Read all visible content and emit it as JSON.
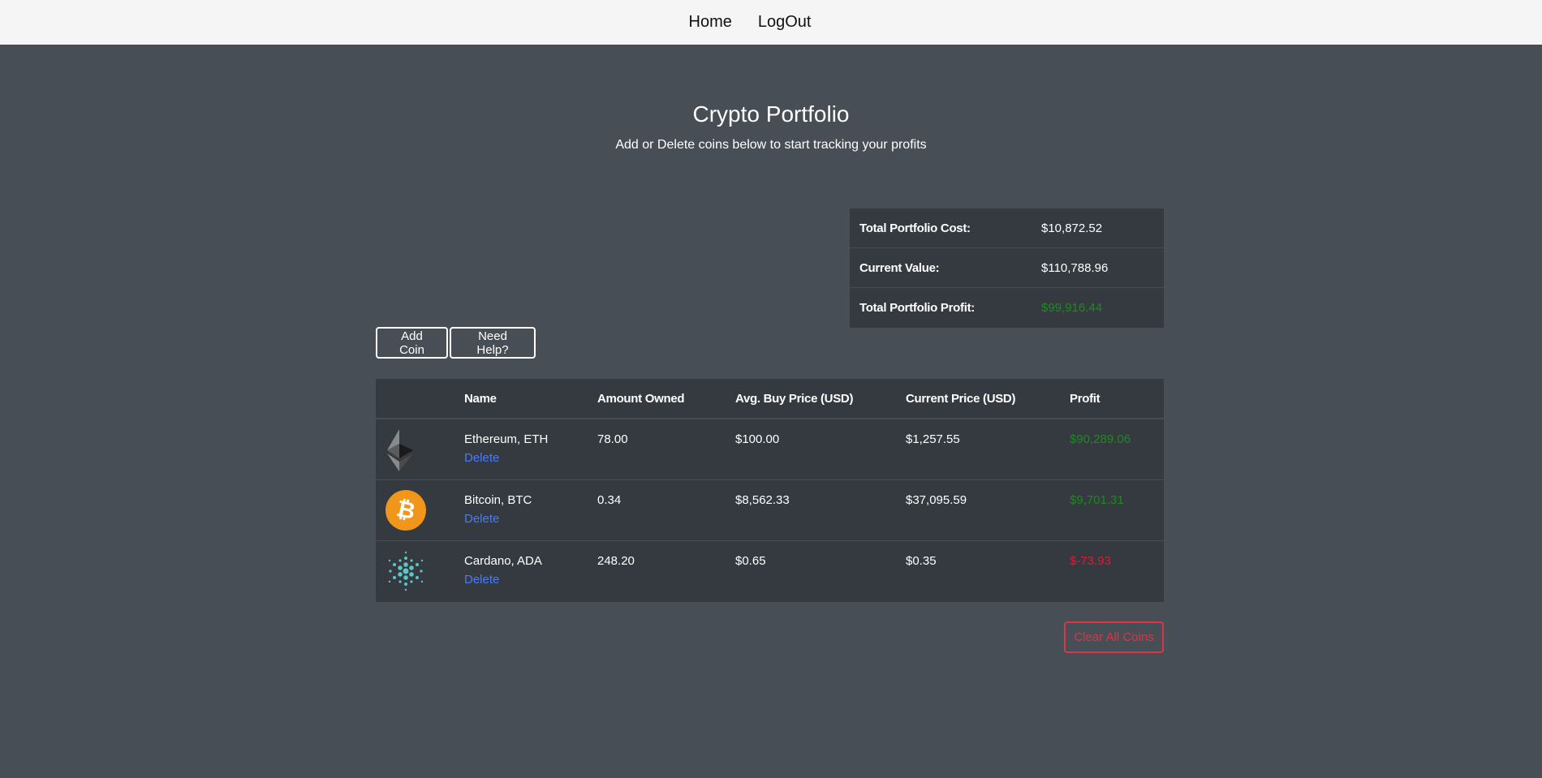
{
  "nav": {
    "home_label": "Home",
    "logout_label": "LogOut"
  },
  "header": {
    "title": "Crypto Portfolio",
    "subtitle": "Add or Delete coins below to start tracking your profits"
  },
  "summary": {
    "rows": [
      {
        "label": "Total Portfolio Cost:",
        "value": "$10,872.52"
      },
      {
        "label": "Current Value:",
        "value": "$110,788.96"
      },
      {
        "label": "Total Portfolio Profit:",
        "value": "$99,916.44"
      }
    ]
  },
  "actions": {
    "add_label": "Add Coin",
    "help_label": "Need Help?",
    "clear_label": "Clear All Coins"
  },
  "table": {
    "headers": [
      "",
      "Name",
      "Amount Owned",
      "Avg. Buy Price (USD)",
      "Current Price (USD)",
      "Profit"
    ],
    "rows": [
      {
        "icon": "ethereum-icon",
        "name": "Ethereum, ETH",
        "delete": "Delete",
        "amount": "78.00",
        "buy": "$100.00",
        "current": "$1,257.55",
        "profit": "$90,289.06"
      },
      {
        "icon": "bitcoin-icon",
        "name": "Bitcoin, BTC",
        "delete": "Delete",
        "amount": "0.34",
        "buy": "$8,562.33",
        "current": "$37,095.59",
        "profit": "$9,701.31"
      },
      {
        "icon": "cardano-icon",
        "name": "Cardano, ADA",
        "delete": "Delete",
        "amount": "248.20",
        "buy": "$0.65",
        "current": "$0.35",
        "profit": "$-73.93"
      }
    ]
  },
  "colors": {
    "background": "#474e56",
    "table_bg": "#343a40",
    "profit_positive": "#1e8a1e",
    "profit_negative": "#e0192f",
    "link": "#4b7bf5",
    "danger": "#dc3545"
  }
}
